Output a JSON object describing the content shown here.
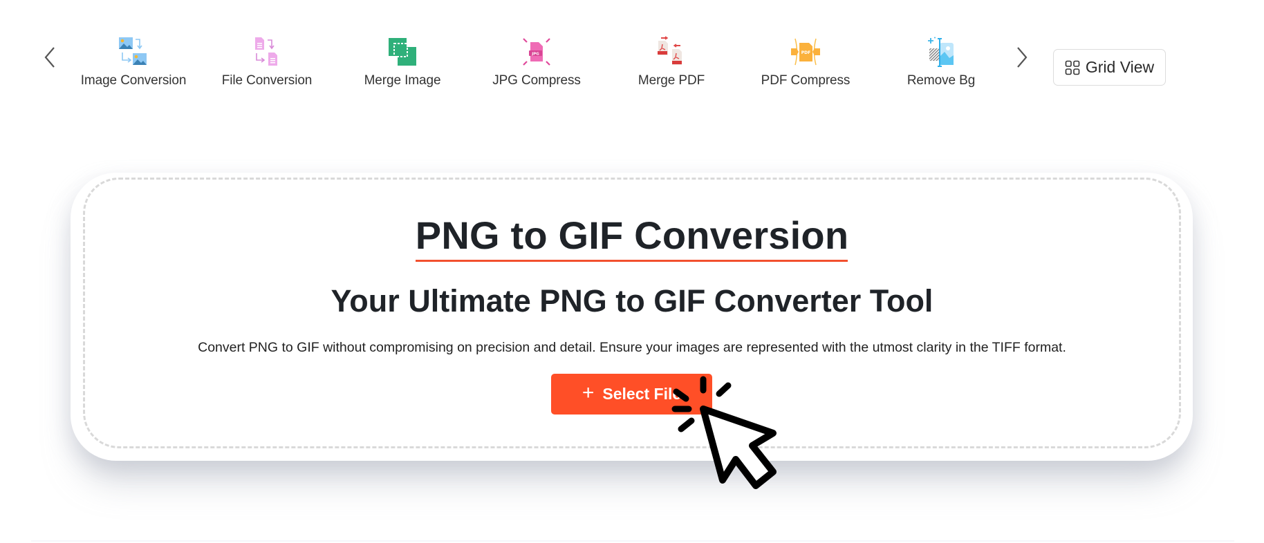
{
  "toolbar": {
    "prev_label": "previous",
    "next_label": "next",
    "items": [
      {
        "label": "Image Conversion",
        "icon": "image-conversion-icon"
      },
      {
        "label": "File Conversion",
        "icon": "file-conversion-icon"
      },
      {
        "label": "Merge Image",
        "icon": "merge-image-icon"
      },
      {
        "label": "JPG Compress",
        "icon": "jpg-compress-icon"
      },
      {
        "label": "Merge PDF",
        "icon": "merge-pdf-icon"
      },
      {
        "label": "PDF Compress",
        "icon": "pdf-compress-icon"
      },
      {
        "label": "Remove Bg",
        "icon": "remove-bg-icon"
      }
    ],
    "grid_view_label": "Grid View"
  },
  "hero": {
    "title": "PNG to GIF Conversion",
    "subtitle": "Your Ultimate PNG to GIF Converter Tool",
    "description": "Convert PNG to GIF without compromising on precision and detail. Ensure your images are represented with the utmost clarity in the TIFF format.",
    "select_button": {
      "icon": "+",
      "label": "Select File"
    }
  },
  "colors": {
    "accent": "#FF4F27",
    "underline": "#F2502E",
    "dashed_border": "#D9D9D9",
    "text": "#1F2328"
  }
}
